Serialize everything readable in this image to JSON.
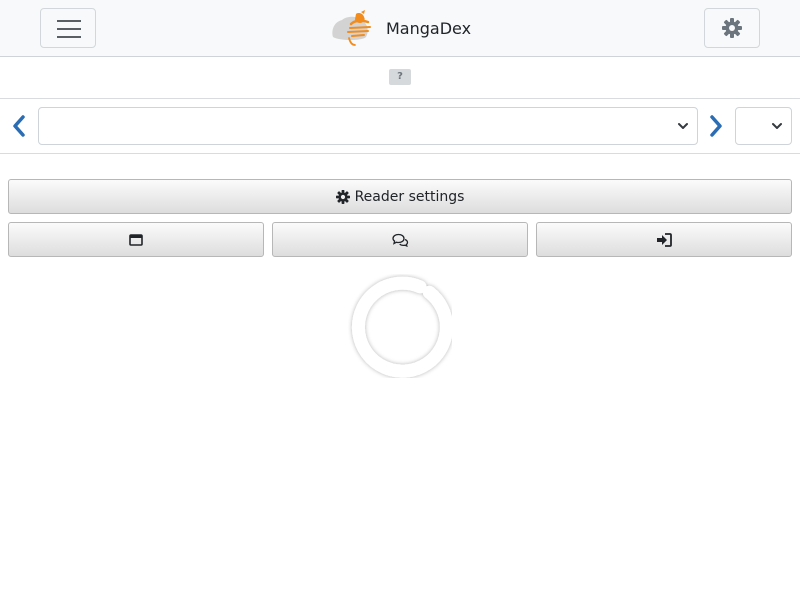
{
  "header": {
    "brand_name": "MangaDex",
    "menu_icon": "hamburger-menu-icon",
    "settings_icon": "gear-icon",
    "brand_colors": {
      "orange": "#f28c1c",
      "gray": "#d0d0d0"
    }
  },
  "help": {
    "badge_text": "?"
  },
  "chapter_nav": {
    "prev_icon": "chevron-left-icon",
    "next_icon": "chevron-right-icon",
    "chapter_select_value": "",
    "page_select_value": "",
    "accent_color": "#2a6db4"
  },
  "toolbar": {
    "reader_settings_label": "Reader settings",
    "reader_settings_icon": "gear-icon",
    "window_icon": "window-icon",
    "comments_icon": "comments-icon",
    "login_icon": "sign-in-icon"
  },
  "loading": {
    "spinner_icon": "loading-spinner-icon"
  }
}
